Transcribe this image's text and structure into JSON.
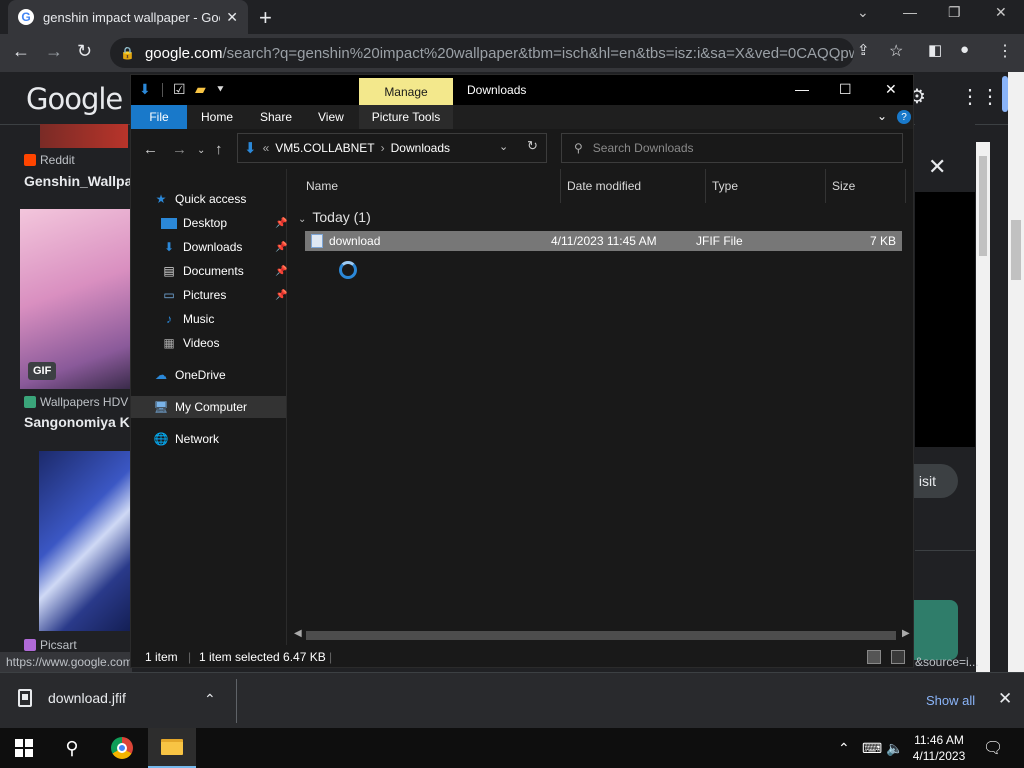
{
  "chrome": {
    "tab_title": "genshin impact wallpaper - Goog",
    "url_host": "google.com",
    "url_rest": "/search?q=genshin%20impact%20wallpaper&tbm=isch&hl=en&tbs=isz:i&sa=X&ved=0CAQQpwVq..."
  },
  "google": {
    "logo": "Google",
    "results": [
      {
        "source": "Reddit",
        "title": "Genshin_Wallpap"
      },
      {
        "source": "Wallpapers HDV",
        "title": "Sangonomiya Ko",
        "badge": "GIF"
      },
      {
        "source": "Picsart",
        "title": ""
      }
    ],
    "visit_label": "isit",
    "status_url": "https://www.google.com",
    "status_right": "&source=i..."
  },
  "explorer": {
    "title": "Downloads",
    "manage_label": "Manage",
    "ribbon_tabs": [
      "File",
      "Home",
      "Share",
      "View",
      "Picture Tools"
    ],
    "help": "?",
    "address": {
      "prefix": "«",
      "root": "VM5.COLLABNET",
      "separator": "›",
      "folder": "Downloads"
    },
    "search_placeholder": "Search Downloads",
    "nav": {
      "quick_access": "Quick access",
      "desktop": "Desktop",
      "downloads": "Downloads",
      "documents": "Documents",
      "pictures": "Pictures",
      "music": "Music",
      "videos": "Videos",
      "onedrive": "OneDrive",
      "my_computer": "My Computer",
      "network": "Network"
    },
    "columns": {
      "name": "Name",
      "date": "Date modified",
      "type": "Type",
      "size": "Size"
    },
    "group_label": "Today (1)",
    "file": {
      "name": "download",
      "date": "4/11/2023 11:45 AM",
      "type": "JFIF File",
      "size": "7 KB"
    },
    "status": {
      "items": "1 item",
      "selected": "1 item selected  6.47 KB"
    }
  },
  "shelf": {
    "file_name": "download.jfif",
    "show_all": "Show all"
  },
  "taskbar": {
    "time": "11:46 AM",
    "date": "4/11/2023"
  },
  "colors": {
    "accent_blue": "#1979ca",
    "manage_yellow": "#f3e88c",
    "link_blue": "#8ab4f8"
  }
}
